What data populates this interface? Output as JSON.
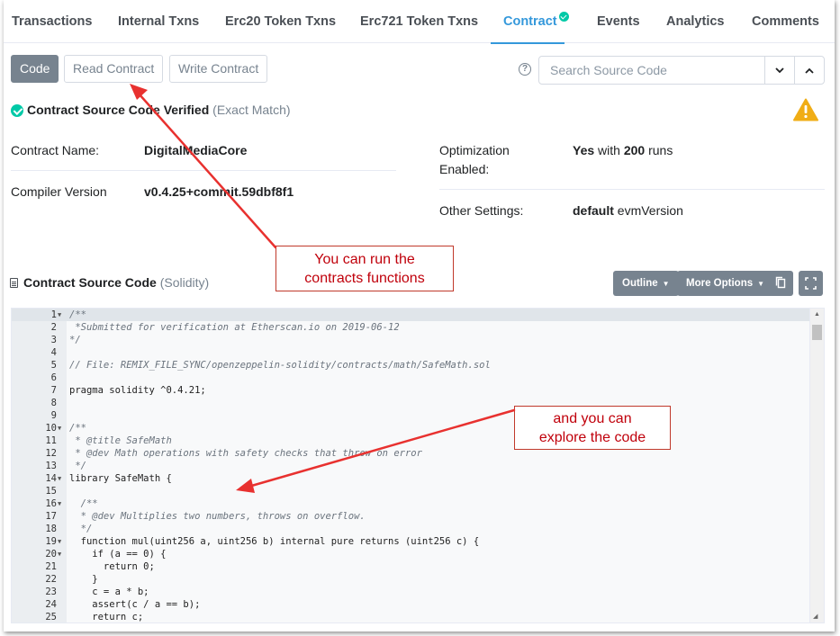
{
  "tabs": [
    {
      "label": "Transactions"
    },
    {
      "label": "Internal Txns"
    },
    {
      "label": "Erc20 Token Txns"
    },
    {
      "label": "Erc721 Token Txns"
    },
    {
      "label": "Contract",
      "active": true,
      "verified": true
    },
    {
      "label": "Events"
    },
    {
      "label": "Analytics"
    },
    {
      "label": "Comments"
    }
  ],
  "toolbar": {
    "code_label": "Code",
    "read_label": "Read Contract",
    "write_label": "Write Contract",
    "help_icon": "?"
  },
  "search": {
    "placeholder": "Search Source Code",
    "down_icon": "chevron-down",
    "up_icon": "chevron-up"
  },
  "verification": {
    "title": "Contract Source Code Verified",
    "note": "(Exact Match)"
  },
  "contract_info": {
    "name_label": "Contract Name:",
    "name_value": "DigitalMediaCore",
    "compiler_label": "Compiler Version",
    "compiler_value": "v0.4.25+commit.59dbf8f1",
    "optimization_label_1": "Optimization",
    "optimization_label_2": "Enabled:",
    "optimization_yes": "Yes",
    "optimization_with": "with",
    "optimization_runs": "200",
    "optimization_runs_word": "runs",
    "other_label": "Other Settings:",
    "other_default": "default",
    "other_evm": "evmVersion"
  },
  "source": {
    "title": "Contract Source Code",
    "language": "(Solidity)",
    "outline_label": "Outline",
    "more_label": "More Options"
  },
  "code_lines": [
    {
      "n": "1",
      "fold": true,
      "text": "/**",
      "type": "comment"
    },
    {
      "n": "2",
      "text": " *Submitted for verification at Etherscan.io on 2019-06-12",
      "type": "comment"
    },
    {
      "n": "3",
      "text": "*/",
      "type": "comment"
    },
    {
      "n": "4",
      "text": "",
      "type": "code"
    },
    {
      "n": "5",
      "text": "// File: REMIX_FILE_SYNC/openzeppelin-solidity/contracts/math/SafeMath.sol",
      "type": "comment"
    },
    {
      "n": "6",
      "text": "",
      "type": "code"
    },
    {
      "n": "7",
      "text": "pragma solidity ^0.4.21;",
      "type": "code"
    },
    {
      "n": "8",
      "text": "",
      "type": "code"
    },
    {
      "n": "9",
      "text": "",
      "type": "code"
    },
    {
      "n": "10",
      "fold": true,
      "text": "/**",
      "type": "comment"
    },
    {
      "n": "11",
      "text": " * @title SafeMath",
      "type": "comment"
    },
    {
      "n": "12",
      "text": " * @dev Math operations with safety checks that throw on error",
      "type": "comment"
    },
    {
      "n": "13",
      "text": " */",
      "type": "comment"
    },
    {
      "n": "14",
      "fold": true,
      "text": "library SafeMath {",
      "type": "code"
    },
    {
      "n": "15",
      "text": "",
      "type": "code"
    },
    {
      "n": "16",
      "fold": true,
      "text": "  /**",
      "type": "comment"
    },
    {
      "n": "17",
      "text": "  * @dev Multiplies two numbers, throws on overflow.",
      "type": "comment"
    },
    {
      "n": "18",
      "text": "  */",
      "type": "comment"
    },
    {
      "n": "19",
      "fold": true,
      "text": "  function mul(uint256 a, uint256 b) internal pure returns (uint256 c) {",
      "type": "code"
    },
    {
      "n": "20",
      "fold": true,
      "text": "    if (a == 0) {",
      "type": "code"
    },
    {
      "n": "21",
      "text": "      return 0;",
      "type": "code"
    },
    {
      "n": "22",
      "text": "    }",
      "type": "code"
    },
    {
      "n": "23",
      "text": "    c = a * b;",
      "type": "code"
    },
    {
      "n": "24",
      "text": "    assert(c / a == b);",
      "type": "code"
    },
    {
      "n": "25",
      "text": "    return c;",
      "type": "code"
    }
  ],
  "annotations": {
    "callout_1_line1": "You can run the",
    "callout_1_line2": "contracts functions",
    "callout_2_line1": "and you can",
    "callout_2_line2": "explore the code",
    "color": "#e8312f"
  },
  "colors": {
    "accent": "#3498db",
    "verified": "#00c9a7",
    "warning": "#f0ad16",
    "button_gray": "#77838f"
  }
}
